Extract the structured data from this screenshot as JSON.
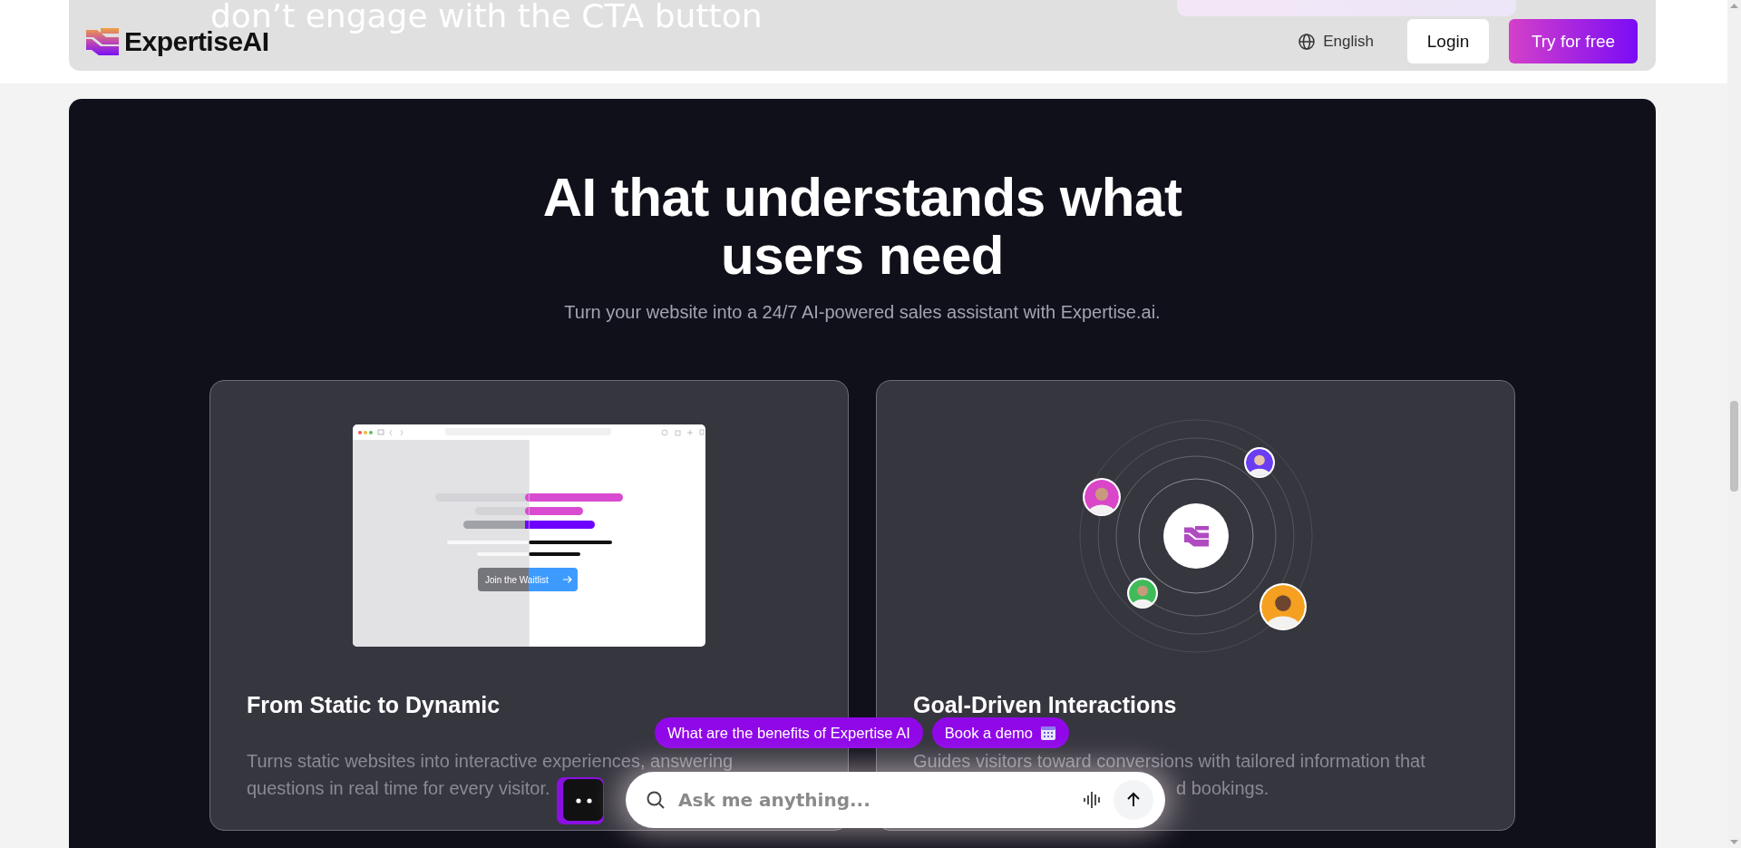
{
  "background_text": "don’t engage with the CTA button",
  "header": {
    "brand": "ExpertiseAI",
    "language": "English",
    "login": "Login",
    "cta": "Try for free"
  },
  "hero": {
    "title": "AI that understands what users need",
    "subtitle": "Turn your website into a 24/7 AI-powered sales assistant with Expertise.ai."
  },
  "features": [
    {
      "kind": "browser-mockup",
      "title": "From Static to Dynamic",
      "mockup_button": "Join the Waitlist",
      "description_lines": [
        {
          "text": "Turns static websites into interactive experiences, answering",
          "partly_covered": false
        },
        {
          "text": "questions in real time for every visitor.",
          "partly_covered": false
        }
      ]
    },
    {
      "kind": "orbit",
      "title": "Goal-Driven Interactions",
      "description_lines": [
        {
          "text": "Guides visitors toward conversions with tailored information that",
          "partly_covered": false
        },
        {
          "text": "d bookings.",
          "partly_covered": true
        }
      ]
    }
  ],
  "chat": {
    "suggestions": [
      "What are the benefits of Expertise AI",
      "Book a demo"
    ],
    "placeholder": "Ask me anything..."
  }
}
